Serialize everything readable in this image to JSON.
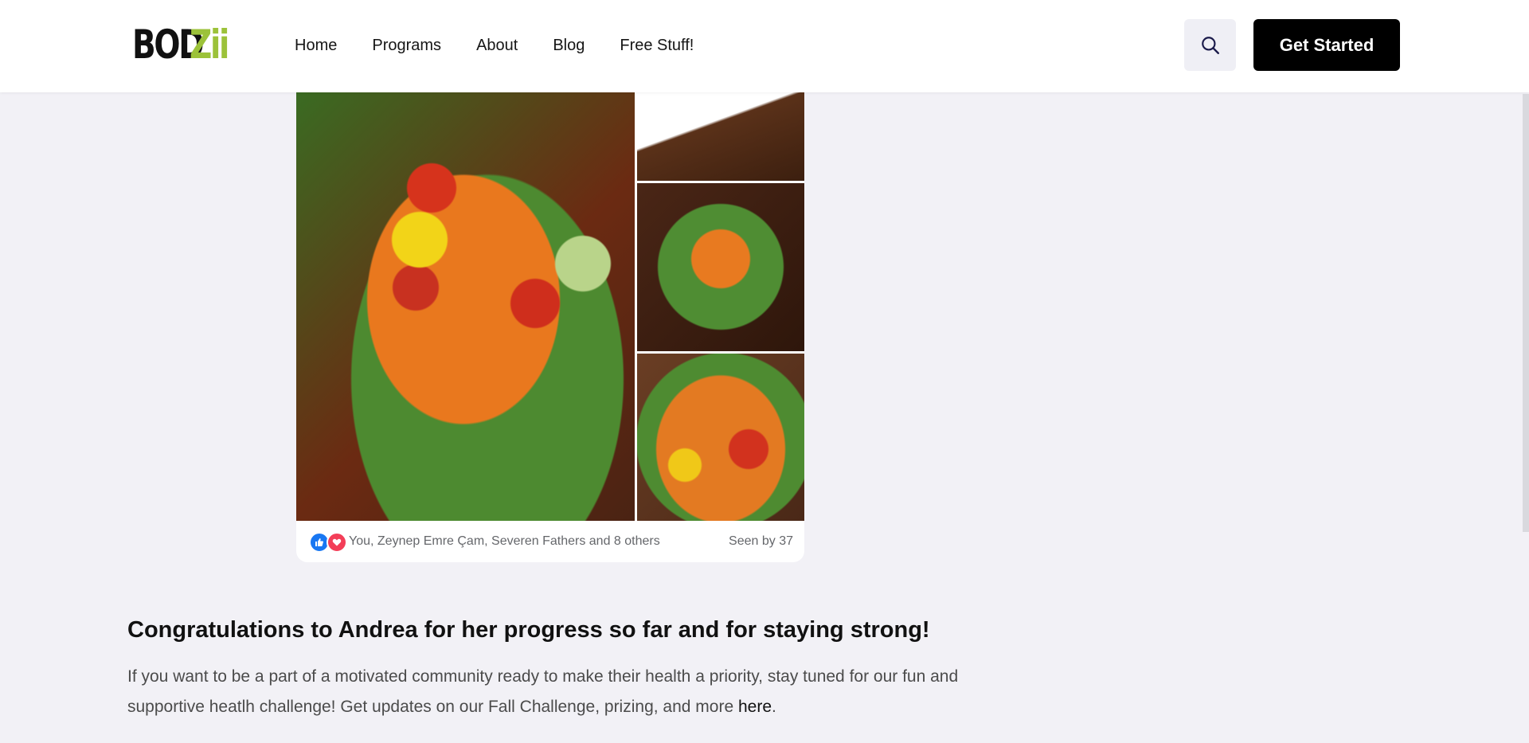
{
  "header": {
    "logo": {
      "part1": "BOD",
      "part2": "Zii"
    },
    "nav": [
      "Home",
      "Programs",
      "About",
      "Blog",
      "Free Stuff!"
    ],
    "search_icon": "search-icon",
    "cta_label": "Get Started"
  },
  "post": {
    "images": [
      "salad-main-photo",
      "salad-top-photo",
      "salad-middle-photo",
      "salad-bottom-photo"
    ],
    "reactions": [
      "like-reaction-icon",
      "love-reaction-icon"
    ],
    "reaction_names": "You, Zeynep Emre Çam, Severen Fathers and 8 others",
    "seen_by": "Seen by 37"
  },
  "article": {
    "heading": "Congratulations to Andrea for her progress so far and for staying strong!",
    "paragraph_text": "If you want to be a part of a motivated community ready to make their health a priority, stay tuned for our fun and supportive heatlh challenge! Get updates on our Fall Challenge, prizing, and more ",
    "link_text": "here",
    "paragraph_end": "."
  },
  "colors": {
    "page_bg": "#f2f1f6",
    "logo_accent": "#9cc23a",
    "cta_bg": "#000000",
    "like_blue": "#1877f2",
    "love_red": "#f33e58"
  }
}
